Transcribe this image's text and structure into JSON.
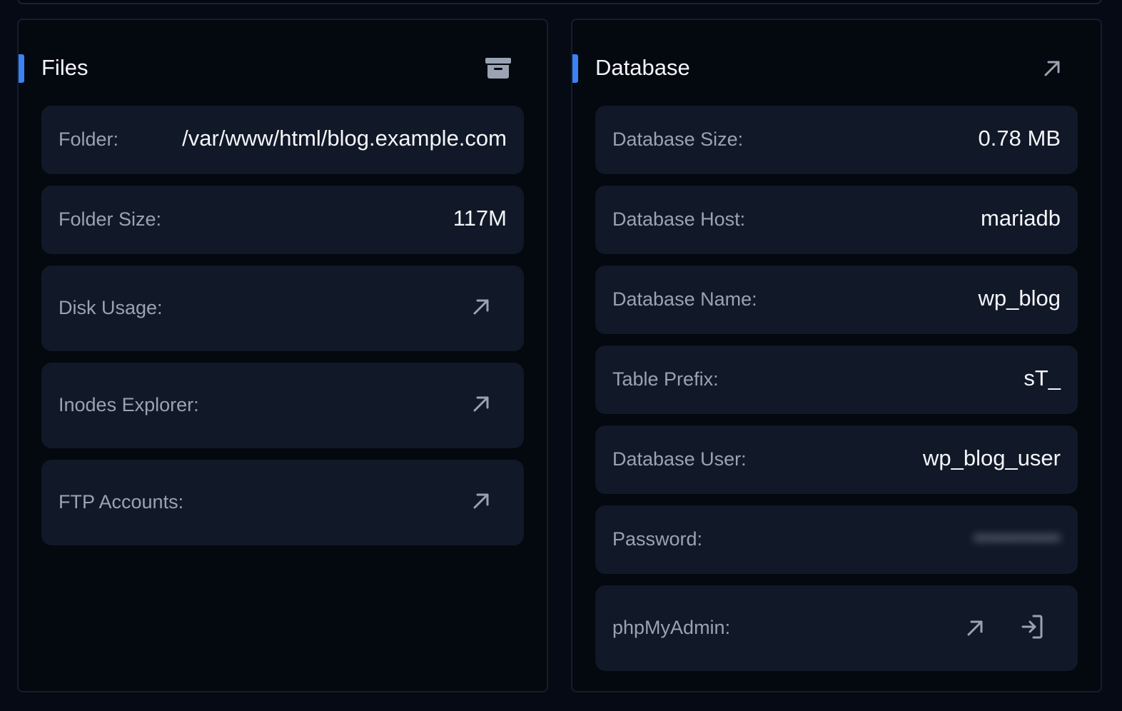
{
  "files": {
    "title": "Files",
    "folder_label": "Folder:",
    "folder_value": "/var/www/html/blog.example.com",
    "folder_size_label": "Folder Size:",
    "folder_size_value": "117M",
    "disk_usage_label": "Disk Usage:",
    "inodes_label": "Inodes Explorer:",
    "ftp_label": "FTP Accounts:"
  },
  "database": {
    "title": "Database",
    "size_label": "Database Size:",
    "size_value": "0.78 MB",
    "host_label": "Database Host:",
    "host_value": "mariadb",
    "name_label": "Database Name:",
    "name_value": "wp_blog",
    "prefix_label": "Table Prefix:",
    "prefix_value": "sT_",
    "user_label": "Database User:",
    "user_value": "wp_blog_user",
    "password_label": "Password:",
    "password_value": "••••••••••••",
    "phpmyadmin_label": "phpMyAdmin:"
  },
  "icons": {
    "archive": "archive-icon",
    "external_link": "arrow-up-right-icon",
    "login": "login-icon"
  },
  "colors": {
    "accent": "#3b82f6",
    "background": "#050a14",
    "card": "#111827"
  }
}
